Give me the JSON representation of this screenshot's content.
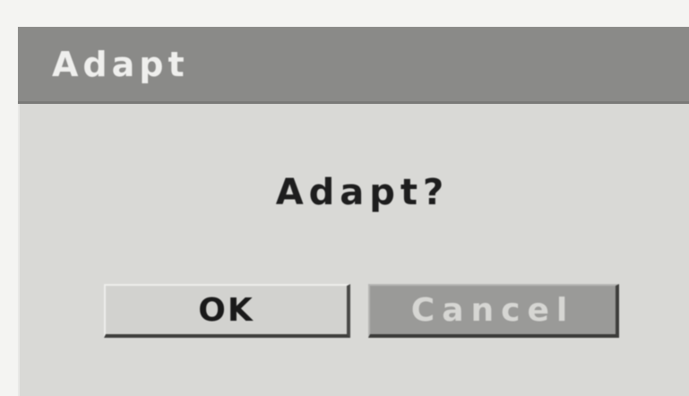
{
  "dialog": {
    "title": "Adapt",
    "message": "Adapt?",
    "ok_label": "OK",
    "cancel_label": "Cancel"
  },
  "colors": {
    "title_bar": "#8a8a88",
    "dialog_background": "#d9d9d6",
    "ok_button": "#d2d2cf",
    "cancel_button": "#9a9a98"
  }
}
